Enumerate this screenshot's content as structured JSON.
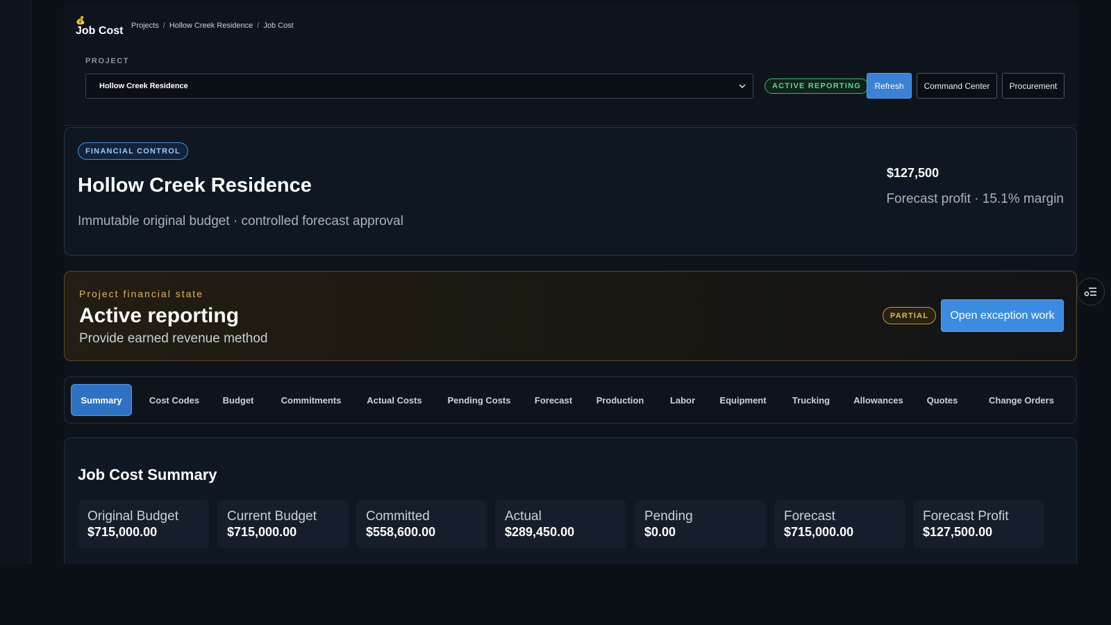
{
  "app": {
    "logo_glyph": "💰",
    "title": "Job Cost"
  },
  "breadcrumb": [
    "Projects",
    "Hollow Creek Residence",
    "Job Cost"
  ],
  "project_selector": {
    "label": "PROJECT",
    "selected": "Hollow Creek Residence"
  },
  "toolbar": {
    "status_pill": "ACTIVE REPORTING",
    "refresh": "Refresh",
    "command_center": "Command Center",
    "procurement": "Procurement"
  },
  "hero": {
    "badge": "FINANCIAL CONTROL",
    "title": "Hollow Creek Residence",
    "subtitle": "Immutable original budget · controlled forecast approval",
    "amount": "$127,500",
    "profit_line": "Forecast profit · 15.1% margin"
  },
  "state": {
    "kicker": "Project financial state",
    "title": "Active reporting",
    "subtitle": "Provide earned revenue method",
    "badge": "PARTIAL",
    "action": "Open exception work"
  },
  "tabs": [
    {
      "label": "Summary",
      "active": true
    },
    {
      "label": "Cost Codes"
    },
    {
      "label": "Budget"
    },
    {
      "label": "Commitments"
    },
    {
      "label": "Actual Costs"
    },
    {
      "label": "Pending Costs"
    },
    {
      "label": "Forecast"
    },
    {
      "label": "Production"
    },
    {
      "label": "Labor"
    },
    {
      "label": "Equipment"
    },
    {
      "label": "Trucking"
    },
    {
      "label": "Allowances"
    },
    {
      "label": "Quotes"
    },
    {
      "label": "Change Orders"
    }
  ],
  "summary": {
    "title": "Job Cost Summary",
    "metrics": [
      {
        "label": "Original Budget",
        "value": "$715,000.00"
      },
      {
        "label": "Current Budget",
        "value": "$715,000.00"
      },
      {
        "label": "Committed",
        "value": "$558,600.00"
      },
      {
        "label": "Actual",
        "value": "$289,450.00"
      },
      {
        "label": "Pending",
        "value": "$0.00"
      },
      {
        "label": "Forecast",
        "value": "$715,000.00"
      },
      {
        "label": "Forecast Profit",
        "value": "$127,500.00"
      }
    ]
  },
  "colors": {
    "accent_blue": "#3b82d6",
    "success_green": "#5fd39a",
    "warning_amber": "#e7b755"
  }
}
